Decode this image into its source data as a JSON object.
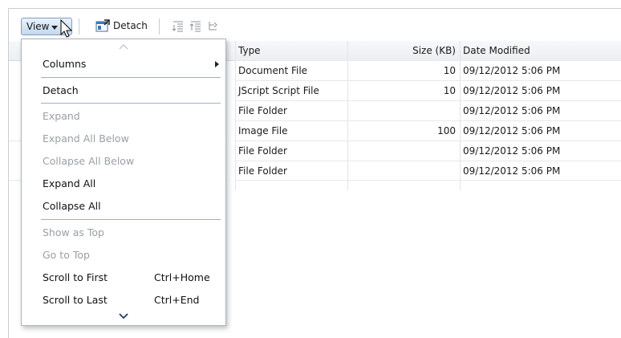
{
  "toolbar": {
    "view_label": "View",
    "detach_label": "Detach"
  },
  "table": {
    "columns": [
      "Type",
      "Size (KB)",
      "Date Modified"
    ],
    "rows": [
      {
        "type": "Document File",
        "size": "10",
        "date": "09/12/2012 5:06 PM"
      },
      {
        "type": "JScript Script File",
        "size": "10",
        "date": "09/12/2012 5:06 PM"
      },
      {
        "type": "File Folder",
        "size": "",
        "date": "09/12/2012 5:06 PM"
      },
      {
        "type": "Image File",
        "size": "100",
        "date": "09/12/2012 5:06 PM"
      },
      {
        "type": "File Folder",
        "size": "",
        "date": "09/12/2012 5:06 PM"
      },
      {
        "type": "File Folder",
        "size": "",
        "date": "09/12/2012 5:06 PM"
      }
    ]
  },
  "menu": {
    "items": [
      {
        "label": "Columns",
        "shortcut": "",
        "enabled": true,
        "submenu": true
      },
      {
        "label": "Detach",
        "shortcut": "",
        "enabled": true
      },
      {
        "label": "Expand",
        "shortcut": "",
        "enabled": false
      },
      {
        "label": "Expand All Below",
        "shortcut": "",
        "enabled": false
      },
      {
        "label": "Collapse All Below",
        "shortcut": "",
        "enabled": false
      },
      {
        "label": "Expand All",
        "shortcut": "",
        "enabled": true
      },
      {
        "label": "Collapse All",
        "shortcut": "",
        "enabled": true
      },
      {
        "label": "Show as Top",
        "shortcut": "",
        "enabled": false
      },
      {
        "label": "Go to Top",
        "shortcut": "",
        "enabled": false
      },
      {
        "label": "Scroll to First",
        "shortcut": "Ctrl+Home",
        "enabled": true
      },
      {
        "label": "Scroll to Last",
        "shortcut": "Ctrl+End",
        "enabled": true
      }
    ]
  },
  "colors": {
    "menu_border": "#aab4bf",
    "separator": "#9db0c4",
    "disabled_text": "#9aa0a6",
    "button_border": "#7d9ec0"
  }
}
